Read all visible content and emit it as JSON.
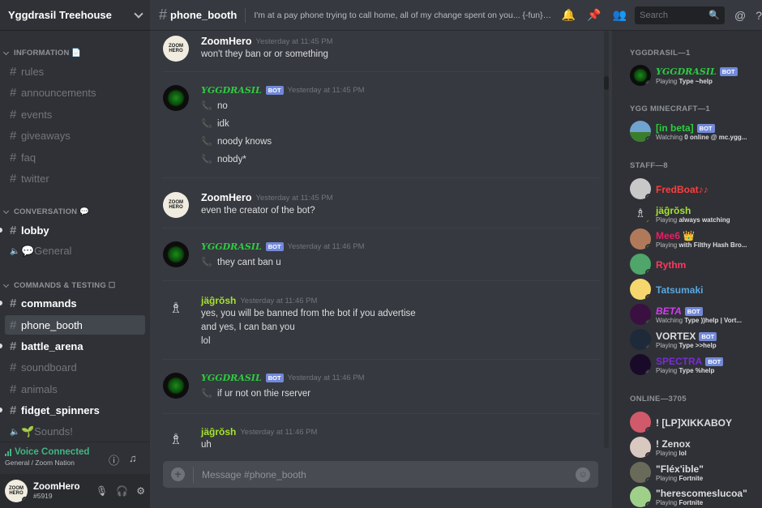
{
  "guild": {
    "name": "Yggdrasil Treehouse"
  },
  "categories": {
    "information": "INFORMATION 📄",
    "conversation": "CONVERSATION 💬",
    "commands": "COMMANDS & TESTING ☐"
  },
  "channels": {
    "rules": "rules",
    "announcements": "announcements",
    "events": "events",
    "giveaways": "giveaways",
    "faq": "faq",
    "twitter": "twitter",
    "lobby": "lobby",
    "general_voice": "💬General",
    "commands": "commands",
    "phone_booth": "phone_booth",
    "battle_arena": "battle_arena",
    "soundboard": "soundboard",
    "animals": "animals",
    "fidget_spinners": "fidget_spinners",
    "sounds_voice": "🌱Sounds!"
  },
  "voice": {
    "status": "Voice Connected",
    "location": "General / Zoom Nation"
  },
  "user": {
    "name": "ZoomHero",
    "tag": "#5919",
    "avatar_text": "ZOOM HERO"
  },
  "header": {
    "channel": "phone_booth",
    "topic": "I'm at a pay phone trying to call home, all of my change spent on you... {-fun}{-...",
    "search_placeholder": "Search"
  },
  "messages": {
    "m1": {
      "author": "ZoomHero",
      "time": "Yesterday at 11:45 PM",
      "lines": [
        "won't they ban or or something"
      ]
    },
    "m2": {
      "author": "YGGDRASIL",
      "bot": "BOT",
      "time": "Yesterday at 11:45 PM",
      "lines": [
        "no",
        "idk",
        "noody knows",
        "nobdy*"
      ]
    },
    "m3": {
      "author": "ZoomHero",
      "time": "Yesterday at 11:45 PM",
      "lines": [
        "even the creator of the bot?"
      ]
    },
    "m4": {
      "author": "YGGDRASIL",
      "bot": "BOT",
      "time": "Yesterday at 11:46 PM",
      "lines": [
        "they cant ban u"
      ]
    },
    "m5": {
      "author": "jäĝrŏsh",
      "time": "Yesterday at 11:46 PM",
      "lines": [
        "yes, you will be banned from the bot if you advertise",
        "and yes, I can ban you",
        "lol"
      ]
    },
    "m6": {
      "author": "YGGDRASIL",
      "bot": "BOT",
      "time": "Yesterday at 11:46 PM",
      "lines": [
        "if ur not on thie rserver"
      ]
    },
    "m7": {
      "author": "jäĝrŏsh",
      "time": "Yesterday at 11:46 PM",
      "lines": [
        "uh"
      ]
    }
  },
  "composer": {
    "placeholder": "Message #phone_booth"
  },
  "members": {
    "cat_yggdrasil": "YGGDRASIL—1",
    "cat_minecraft": "YGG MINECRAFT—1",
    "cat_staff": "STAFF—8",
    "cat_online": "ONLINE—3705",
    "yggdrasil": {
      "name": "YGGDRASIL",
      "bot": "BOT",
      "act_prefix": "Playing",
      "act": "Type ~help"
    },
    "inbeta": {
      "name": "[in beta]",
      "bot": "BOT",
      "act_prefix": "Watching",
      "act": "0 online @ mc.ygg..."
    },
    "fredboat": {
      "name": "FredBoat♪♪"
    },
    "jagrosh": {
      "name": "jäĝrŏsh",
      "act_prefix": "Playing",
      "act": "always watching"
    },
    "mee6": {
      "name": "Mee6 👑",
      "act_prefix": "Playing",
      "act": "with Filthy Hash Bro..."
    },
    "rythm": {
      "name": "Rythm"
    },
    "tatsumaki": {
      "name": "Tatsumaki"
    },
    "beta": {
      "name": "BETA",
      "bot": "BOT",
      "act_prefix": "Watching",
      "act": "Type ))help | Vort..."
    },
    "vortex": {
      "name": "VORTEX",
      "bot": "BOT",
      "act_prefix": "Playing",
      "act": "Type >>help"
    },
    "spectra": {
      "name": "SPECTRA",
      "bot": "BOT",
      "act_prefix": "Playing",
      "act": "Type %help"
    },
    "xikkaboy": {
      "name": "! [LP]XIKKABOY"
    },
    "zenox": {
      "name": "! Zenox",
      "act_prefix": "Playing",
      "act": "lol"
    },
    "flexible": {
      "name": "\"Fléx'ible\"",
      "act_prefix": "Playing",
      "act": "Fortnite"
    },
    "herescomeslucoa": {
      "name": "\"herescomeslucoa\"",
      "act_prefix": "Playing",
      "act": "Fortnite"
    }
  },
  "colors": {
    "online": "#43b581",
    "idle": "#faa61a",
    "dnd": "#f04747",
    "bot_tag": "#7289da",
    "fredboat": "#ff3d3d",
    "mee6": "#e91e63",
    "rythm": "#ff3860",
    "tatsumaki": "#5aa7e0",
    "beta": "#d63cf0",
    "spectra": "#7a2bd6",
    "yggdrasil": "#2ecc40",
    "jagrosh": "#a6e22e"
  },
  "icons": [
    "chevron-down-icon",
    "hash-icon",
    "speaker-icon",
    "bell-icon",
    "pin-icon",
    "members-icon",
    "search-icon",
    "at-icon",
    "help-icon",
    "info-icon",
    "soundboard-icon",
    "mic-mute-icon",
    "headphones-icon",
    "gear-icon",
    "add-icon",
    "emoji-icon",
    "phone-icon"
  ]
}
